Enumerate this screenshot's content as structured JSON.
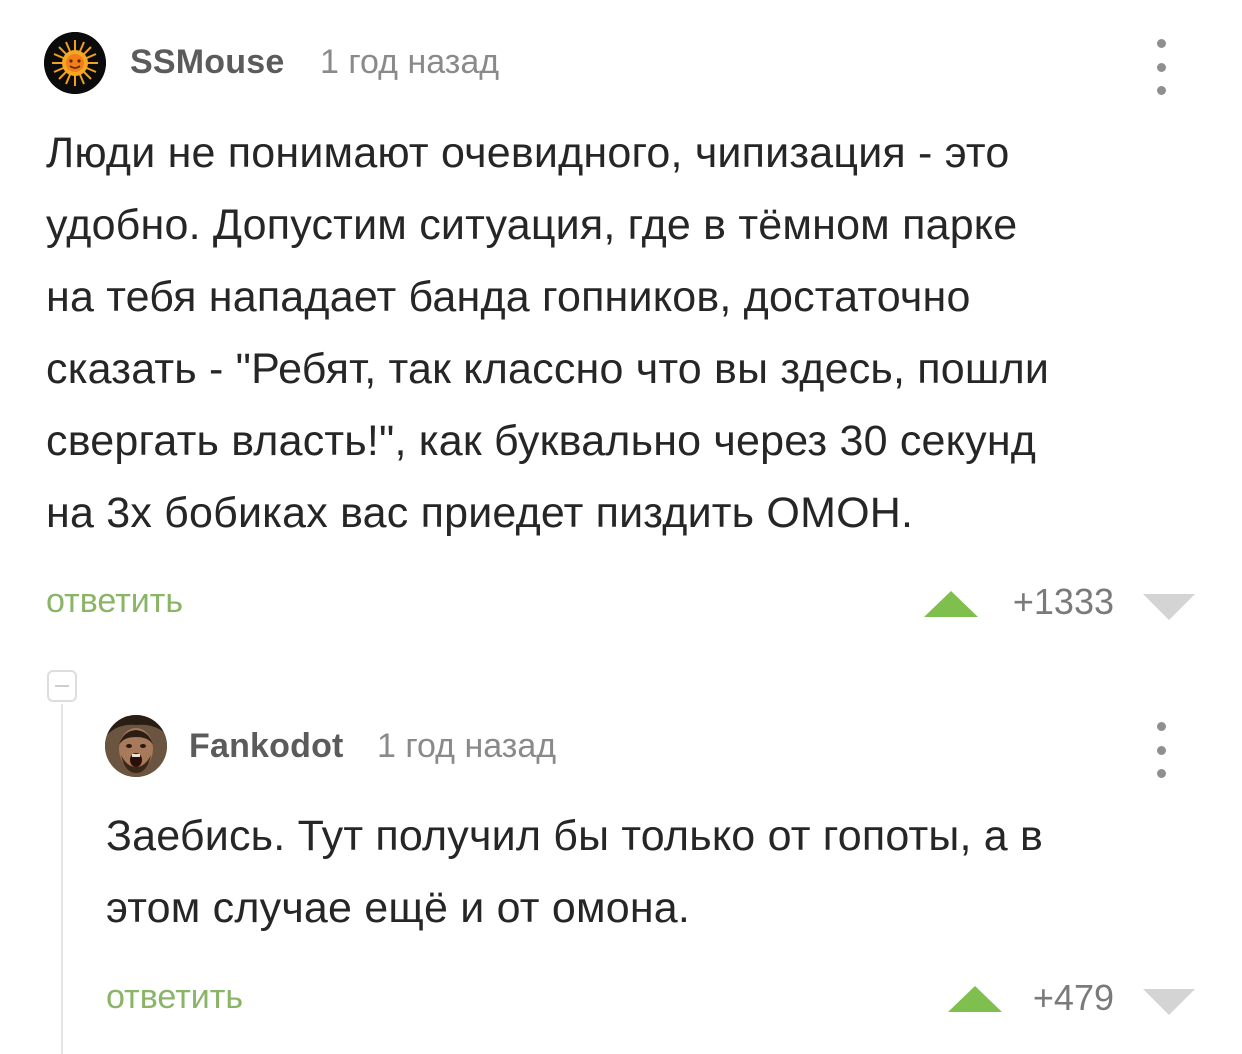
{
  "comments": [
    {
      "author": "SSMouse",
      "time": "1 год назад",
      "text_lines": [
        "Люди не понимают очевидного, чипизация - это",
        "удобно. Допустим ситуация, где в тёмном парке",
        "на тебя нападает банда гопников, достаточно",
        "сказать - \"Ребят, так классно что вы здесь, пошли",
        "свергать власть!\", как буквально через 30 секунд",
        "на 3х бобиках вас приедет пиздить ОМОН."
      ],
      "reply_label": "ответить",
      "score": "+1333"
    },
    {
      "author": "Fankodot",
      "time": "1 год назад",
      "text_lines": [
        "Заебись. Тут получил бы только от гопоты, а в",
        "этом случае ещё и от омона."
      ],
      "reply_label": "ответить",
      "score": "+479"
    }
  ],
  "colors": {
    "accent_green": "#8ab567",
    "upvote": "#7fbf4d",
    "downvote": "#d4d4d4"
  },
  "icons": {
    "avatar1": "sun-avatar",
    "avatar2": "warrior-face-avatar",
    "menu": "kebab-menu-icon",
    "upvote": "triangle-up-icon",
    "downvote": "triangle-down-icon",
    "collapse": "minus-box-icon"
  }
}
